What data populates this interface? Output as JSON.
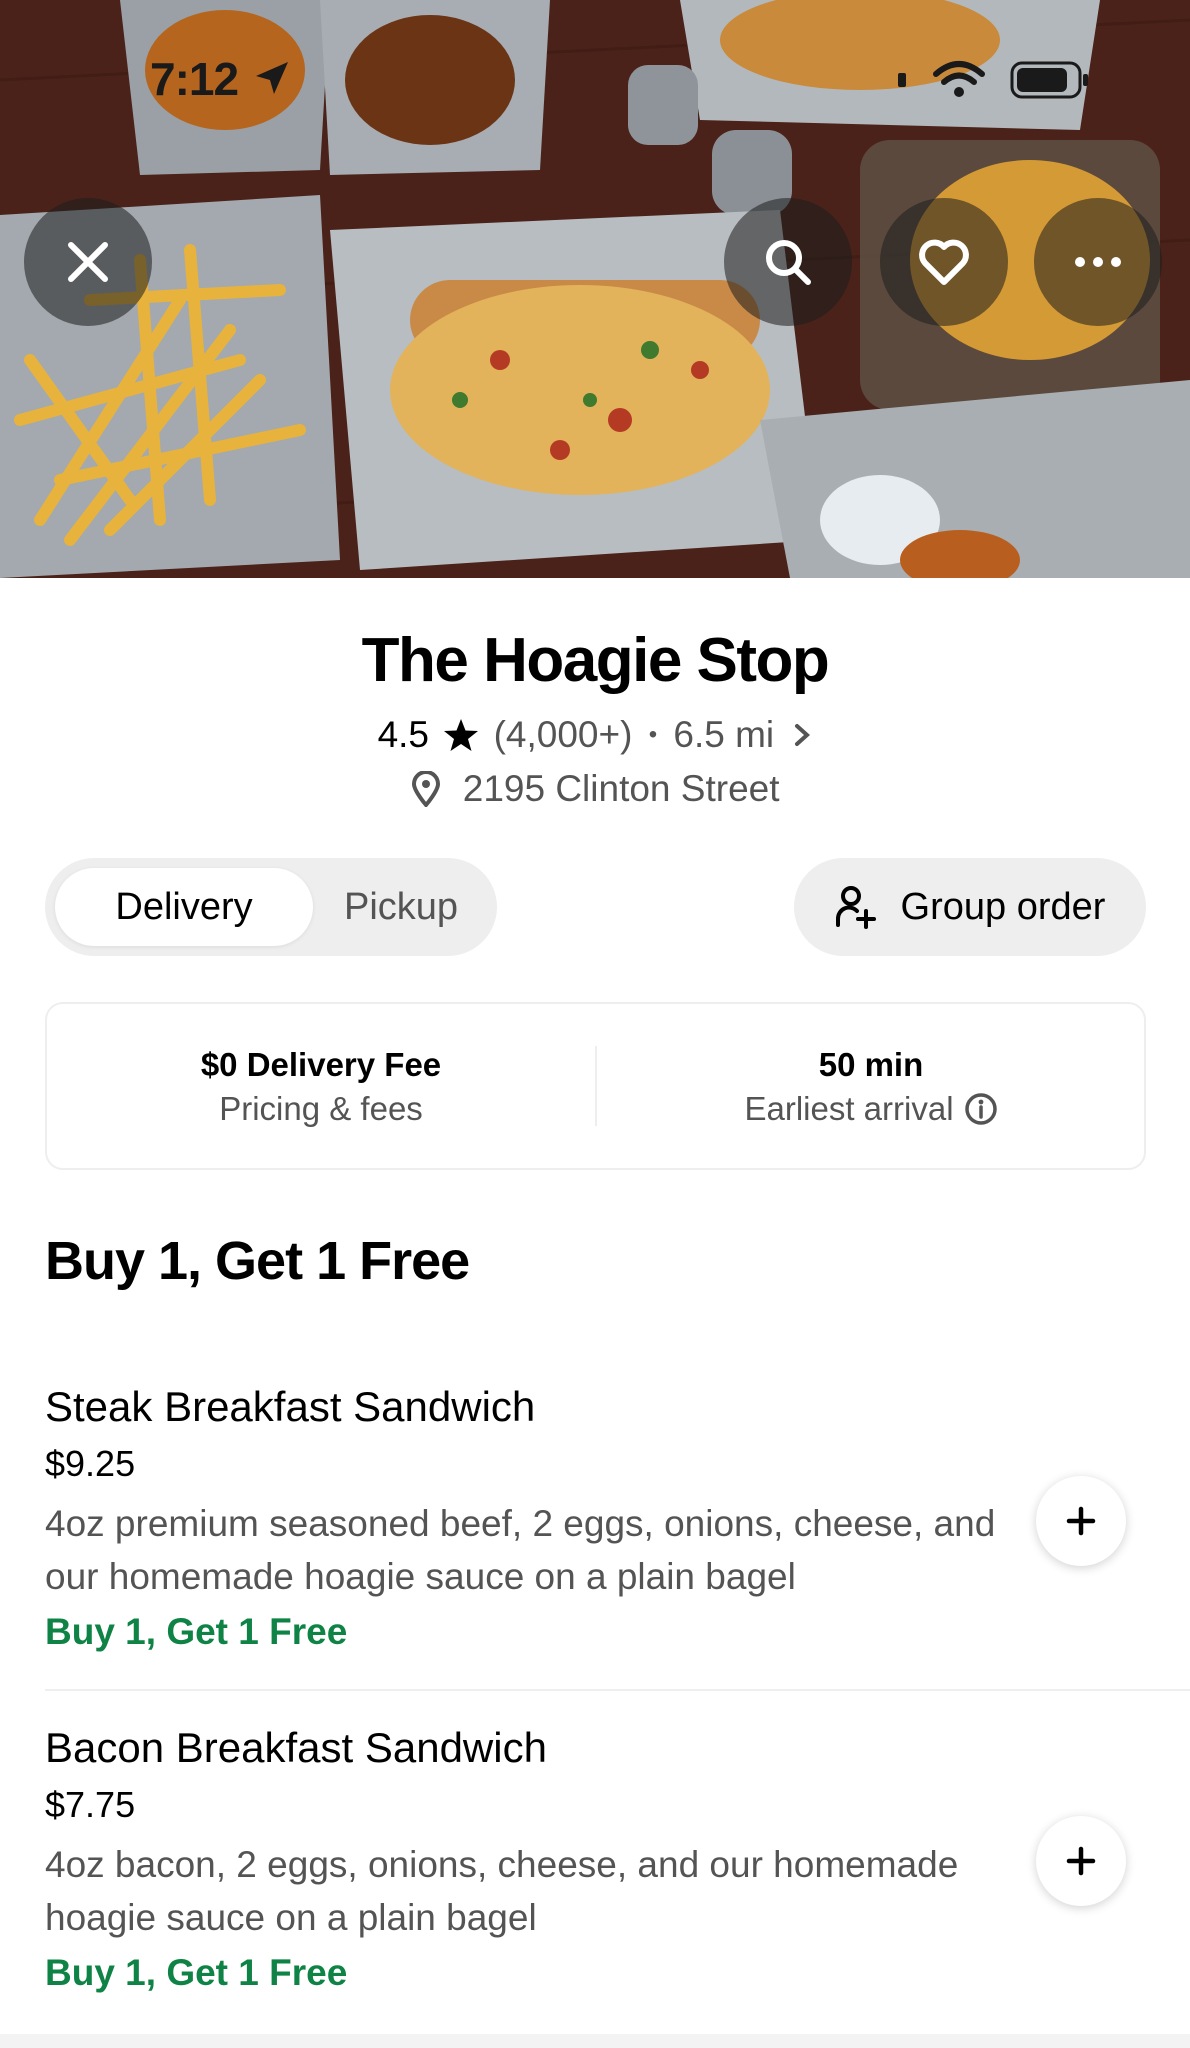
{
  "status_bar": {
    "time": "7:12"
  },
  "hero": {
    "icons": [
      "close-icon",
      "search-icon",
      "heart-icon",
      "more-icon"
    ]
  },
  "store": {
    "name": "The Hoagie Stop",
    "rating": "4.5",
    "rating_count": "(4,000+)",
    "separator": "•",
    "distance": "6.5 mi",
    "address": "2195 Clinton Street"
  },
  "mode_toggle": {
    "delivery_label": "Delivery",
    "pickup_label": "Pickup",
    "selected": "Delivery"
  },
  "group_order": {
    "label": "Group order"
  },
  "info_card": {
    "fee_main": "$0 Delivery Fee",
    "fee_sub": "Pricing & fees",
    "time_main": "50 min",
    "time_sub": "Earliest arrival"
  },
  "section": {
    "title": "Buy 1, Get 1 Free"
  },
  "menu_items": [
    {
      "name": "Steak Breakfast Sandwich",
      "price": "$9.25",
      "description": "4oz premium seasoned beef, 2 eggs, onions, cheese, and our homemade hoagie sauce on a plain bagel",
      "promo": "Buy 1, Get 1 Free"
    },
    {
      "name": "Bacon Breakfast Sandwich",
      "price": "$7.75",
      "description": "4oz bacon, 2 eggs, onions, cheese, and our homemade hoagie sauce on a plain bagel",
      "promo": "Buy 1, Get 1 Free"
    }
  ],
  "colors": {
    "promo_green": "#0e8345",
    "muted_text": "#545454",
    "pill_bg": "#eeeeee"
  }
}
